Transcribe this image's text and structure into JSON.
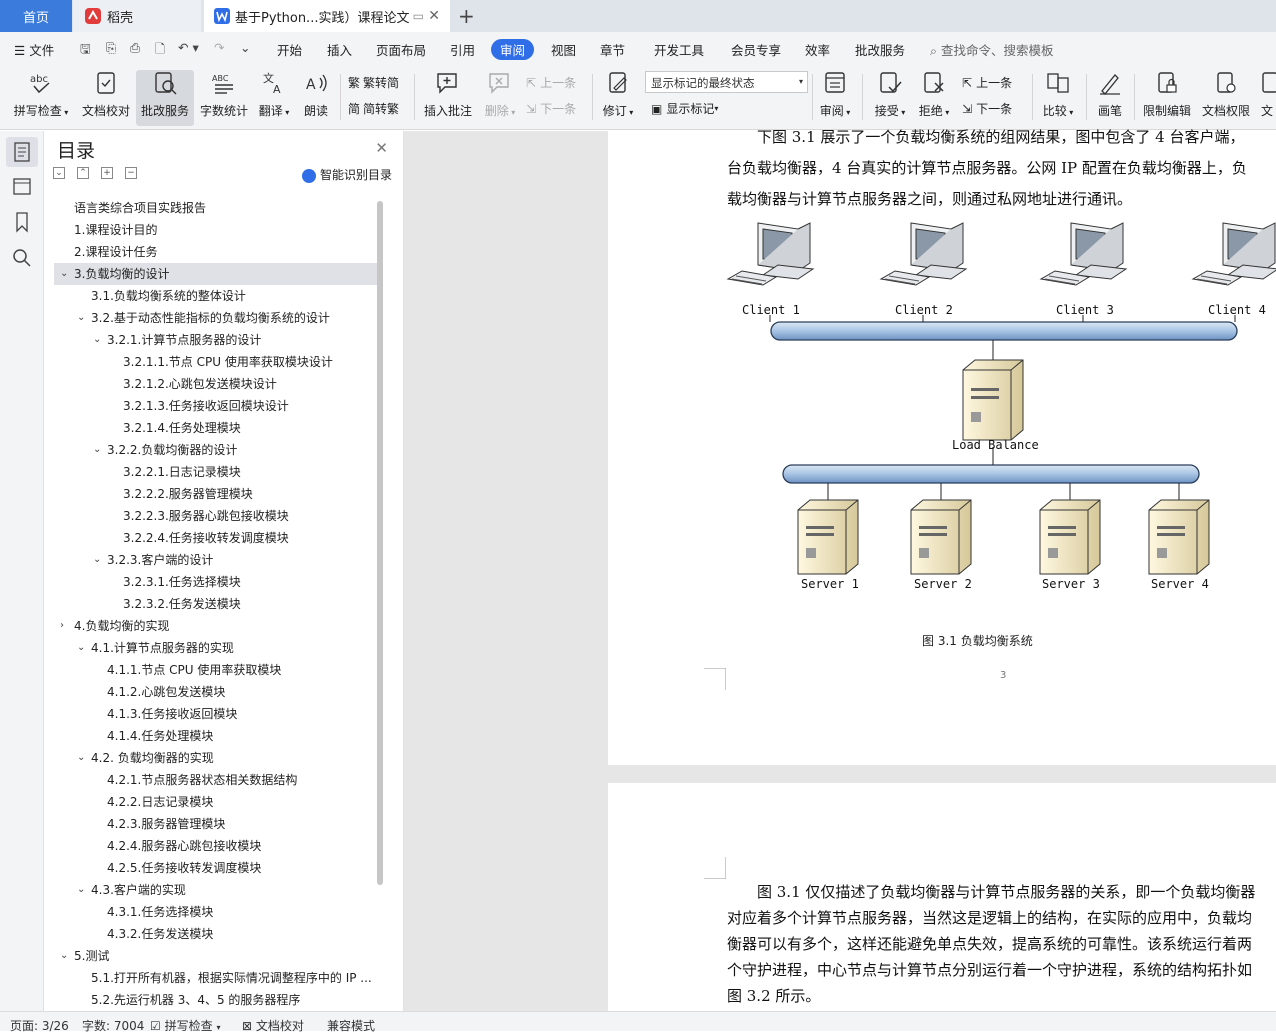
{
  "tabs": {
    "home": "首页",
    "daoke": "稻壳",
    "doc": "基于Python...实践）课程论文",
    "add": "+"
  },
  "menu": {
    "file": "文件",
    "items": [
      "开始",
      "插入",
      "页面布局",
      "引用",
      "审阅",
      "视图",
      "章节",
      "开发工具",
      "会员专享",
      "效率",
      "批改服务"
    ],
    "search_placeholder": "查找命令、搜索模板"
  },
  "ribbon": {
    "spell": "拼写检查",
    "proof": "文档校对",
    "grade": "批改服务",
    "wordcount": "字数统计",
    "translate": "翻译",
    "read": "朗读",
    "to_trad": "繁转简",
    "to_simp": "简转繁",
    "insert_comment": "插入批注",
    "delete": "删除",
    "prev_comment": "上一条",
    "next_comment": "下一条",
    "revise": "修订",
    "markup_state": "显示标记的最终状态",
    "show_markup": "显示标记",
    "review": "审阅",
    "accept": "接受",
    "reject": "拒绝",
    "prev_change": "上一条",
    "next_change": "下一条",
    "compare": "比较",
    "pen": "画笔",
    "restrict": "限制编辑",
    "permission": "文档权限",
    "more": "文"
  },
  "toc": {
    "title": "目录",
    "smart": "智能识别目录",
    "items": [
      {
        "text": "语言类综合项目实践报告",
        "level": 0,
        "arrow": ""
      },
      {
        "text": "1.课程设计目的",
        "level": 0,
        "arrow": ""
      },
      {
        "text": "2.课程设计任务",
        "level": 0,
        "arrow": ""
      },
      {
        "text": "3.负载均衡的设计",
        "level": 0,
        "arrow": "down",
        "selected": true
      },
      {
        "text": "3.1.负载均衡系统的整体设计",
        "level": 1,
        "arrow": ""
      },
      {
        "text": "3.2.基于动态性能指标的负载均衡系统的设计",
        "level": 1,
        "arrow": "down"
      },
      {
        "text": "3.2.1.计算节点服务器的设计",
        "level": 2,
        "arrow": "down"
      },
      {
        "text": "3.2.1.1.节点 CPU 使用率获取模块设计",
        "level": 3,
        "arrow": ""
      },
      {
        "text": "3.2.1.2.心跳包发送模块设计",
        "level": 3,
        "arrow": ""
      },
      {
        "text": "3.2.1.3.任务接收返回模块设计",
        "level": 3,
        "arrow": ""
      },
      {
        "text": "3.2.1.4.任务处理模块",
        "level": 3,
        "arrow": ""
      },
      {
        "text": "3.2.2.负载均衡器的设计",
        "level": 2,
        "arrow": "down"
      },
      {
        "text": "3.2.2.1.日志记录模块",
        "level": 3,
        "arrow": ""
      },
      {
        "text": "3.2.2.2.服务器管理模块",
        "level": 3,
        "arrow": ""
      },
      {
        "text": "3.2.2.3.服务器心跳包接收模块",
        "level": 3,
        "arrow": ""
      },
      {
        "text": "3.2.2.4.任务接收转发调度模块",
        "level": 3,
        "arrow": ""
      },
      {
        "text": "3.2.3.客户端的设计",
        "level": 2,
        "arrow": "down"
      },
      {
        "text": "3.2.3.1.任务选择模块",
        "level": 3,
        "arrow": ""
      },
      {
        "text": "3.2.3.2.任务发送模块",
        "level": 3,
        "arrow": ""
      },
      {
        "text": "4.负载均衡的实现",
        "level": 0,
        "arrow": "right"
      },
      {
        "text": "4.1.计算节点服务器的实现",
        "level": 1,
        "arrow": "down"
      },
      {
        "text": "4.1.1.节点 CPU 使用率获取模块",
        "level": 2,
        "arrow": ""
      },
      {
        "text": "4.1.2.心跳包发送模块",
        "level": 2,
        "arrow": ""
      },
      {
        "text": "4.1.3.任务接收返回模块",
        "level": 2,
        "arrow": ""
      },
      {
        "text": "4.1.4.任务处理模块",
        "level": 2,
        "arrow": ""
      },
      {
        "text": "4.2. 负载均衡器的实现",
        "level": 1,
        "arrow": "down"
      },
      {
        "text": "4.2.1.节点服务器状态相关数据结构",
        "level": 2,
        "arrow": ""
      },
      {
        "text": "4.2.2.日志记录模块",
        "level": 2,
        "arrow": ""
      },
      {
        "text": "4.2.3.服务器管理模块",
        "level": 2,
        "arrow": ""
      },
      {
        "text": "4.2.4.服务器心跳包接收模块",
        "level": 2,
        "arrow": ""
      },
      {
        "text": "4.2.5.任务接收转发调度模块",
        "level": 2,
        "arrow": ""
      },
      {
        "text": "4.3.客户端的实现",
        "level": 1,
        "arrow": "down"
      },
      {
        "text": "4.3.1.任务选择模块",
        "level": 2,
        "arrow": ""
      },
      {
        "text": "4.3.2.任务发送模块",
        "level": 2,
        "arrow": ""
      },
      {
        "text": "5.测试",
        "level": 0,
        "arrow": "down"
      },
      {
        "text": "5.1.打开所有机器，根据实际情况调整程序中的 IP ...",
        "level": 1,
        "arrow": ""
      },
      {
        "text": "5.2.先运行机器 3、4、5 的服务器程序",
        "level": 1,
        "arrow": ""
      }
    ]
  },
  "doc": {
    "p1_lines": [
      "下图 3.1 展示了一个负载均衡系统的组网结果，图中包含了 4 台客户端，",
      "台负载均衡器，4 台真实的计算节点服务器。公网 IP 配置在负载均衡器上，负",
      "载均衡器与计算节点服务器之间，则通过私网地址进行通讯。"
    ],
    "clients": [
      "Client 1",
      "Client 2",
      "Client 3",
      "Client 4"
    ],
    "balancer": "Load Balance",
    "servers": [
      "Server 1",
      "Server 2",
      "Server 3",
      "Server 4"
    ],
    "caption": "图 3.1 负载均衡系统",
    "page_number": "3",
    "p2_lines": [
      "图 3.1 仅仅描述了负载均衡器与计算节点服务器的关系，即一个负载均衡器",
      "对应着多个计算节点服务器，当然这是逻辑上的结构，在实际的应用中，负载均",
      "衡器可以有多个，这样还能避免单点失效，提高系统的可靠性。该系统运行着两",
      "个守护进程，中心节点与计算节点分别运行着一个守护进程，系统的结构拓扑如",
      "图 3.2 所示。"
    ]
  },
  "status": {
    "page": "页面: 3/26",
    "words": "字数: 7004",
    "spell": "拼写检查",
    "proof": "文档校对",
    "compat": "兼容模式"
  },
  "colors": {
    "accent": "#2f6ee6",
    "home_tab": "#3a7bdc",
    "bus": "#a8c4e4"
  }
}
